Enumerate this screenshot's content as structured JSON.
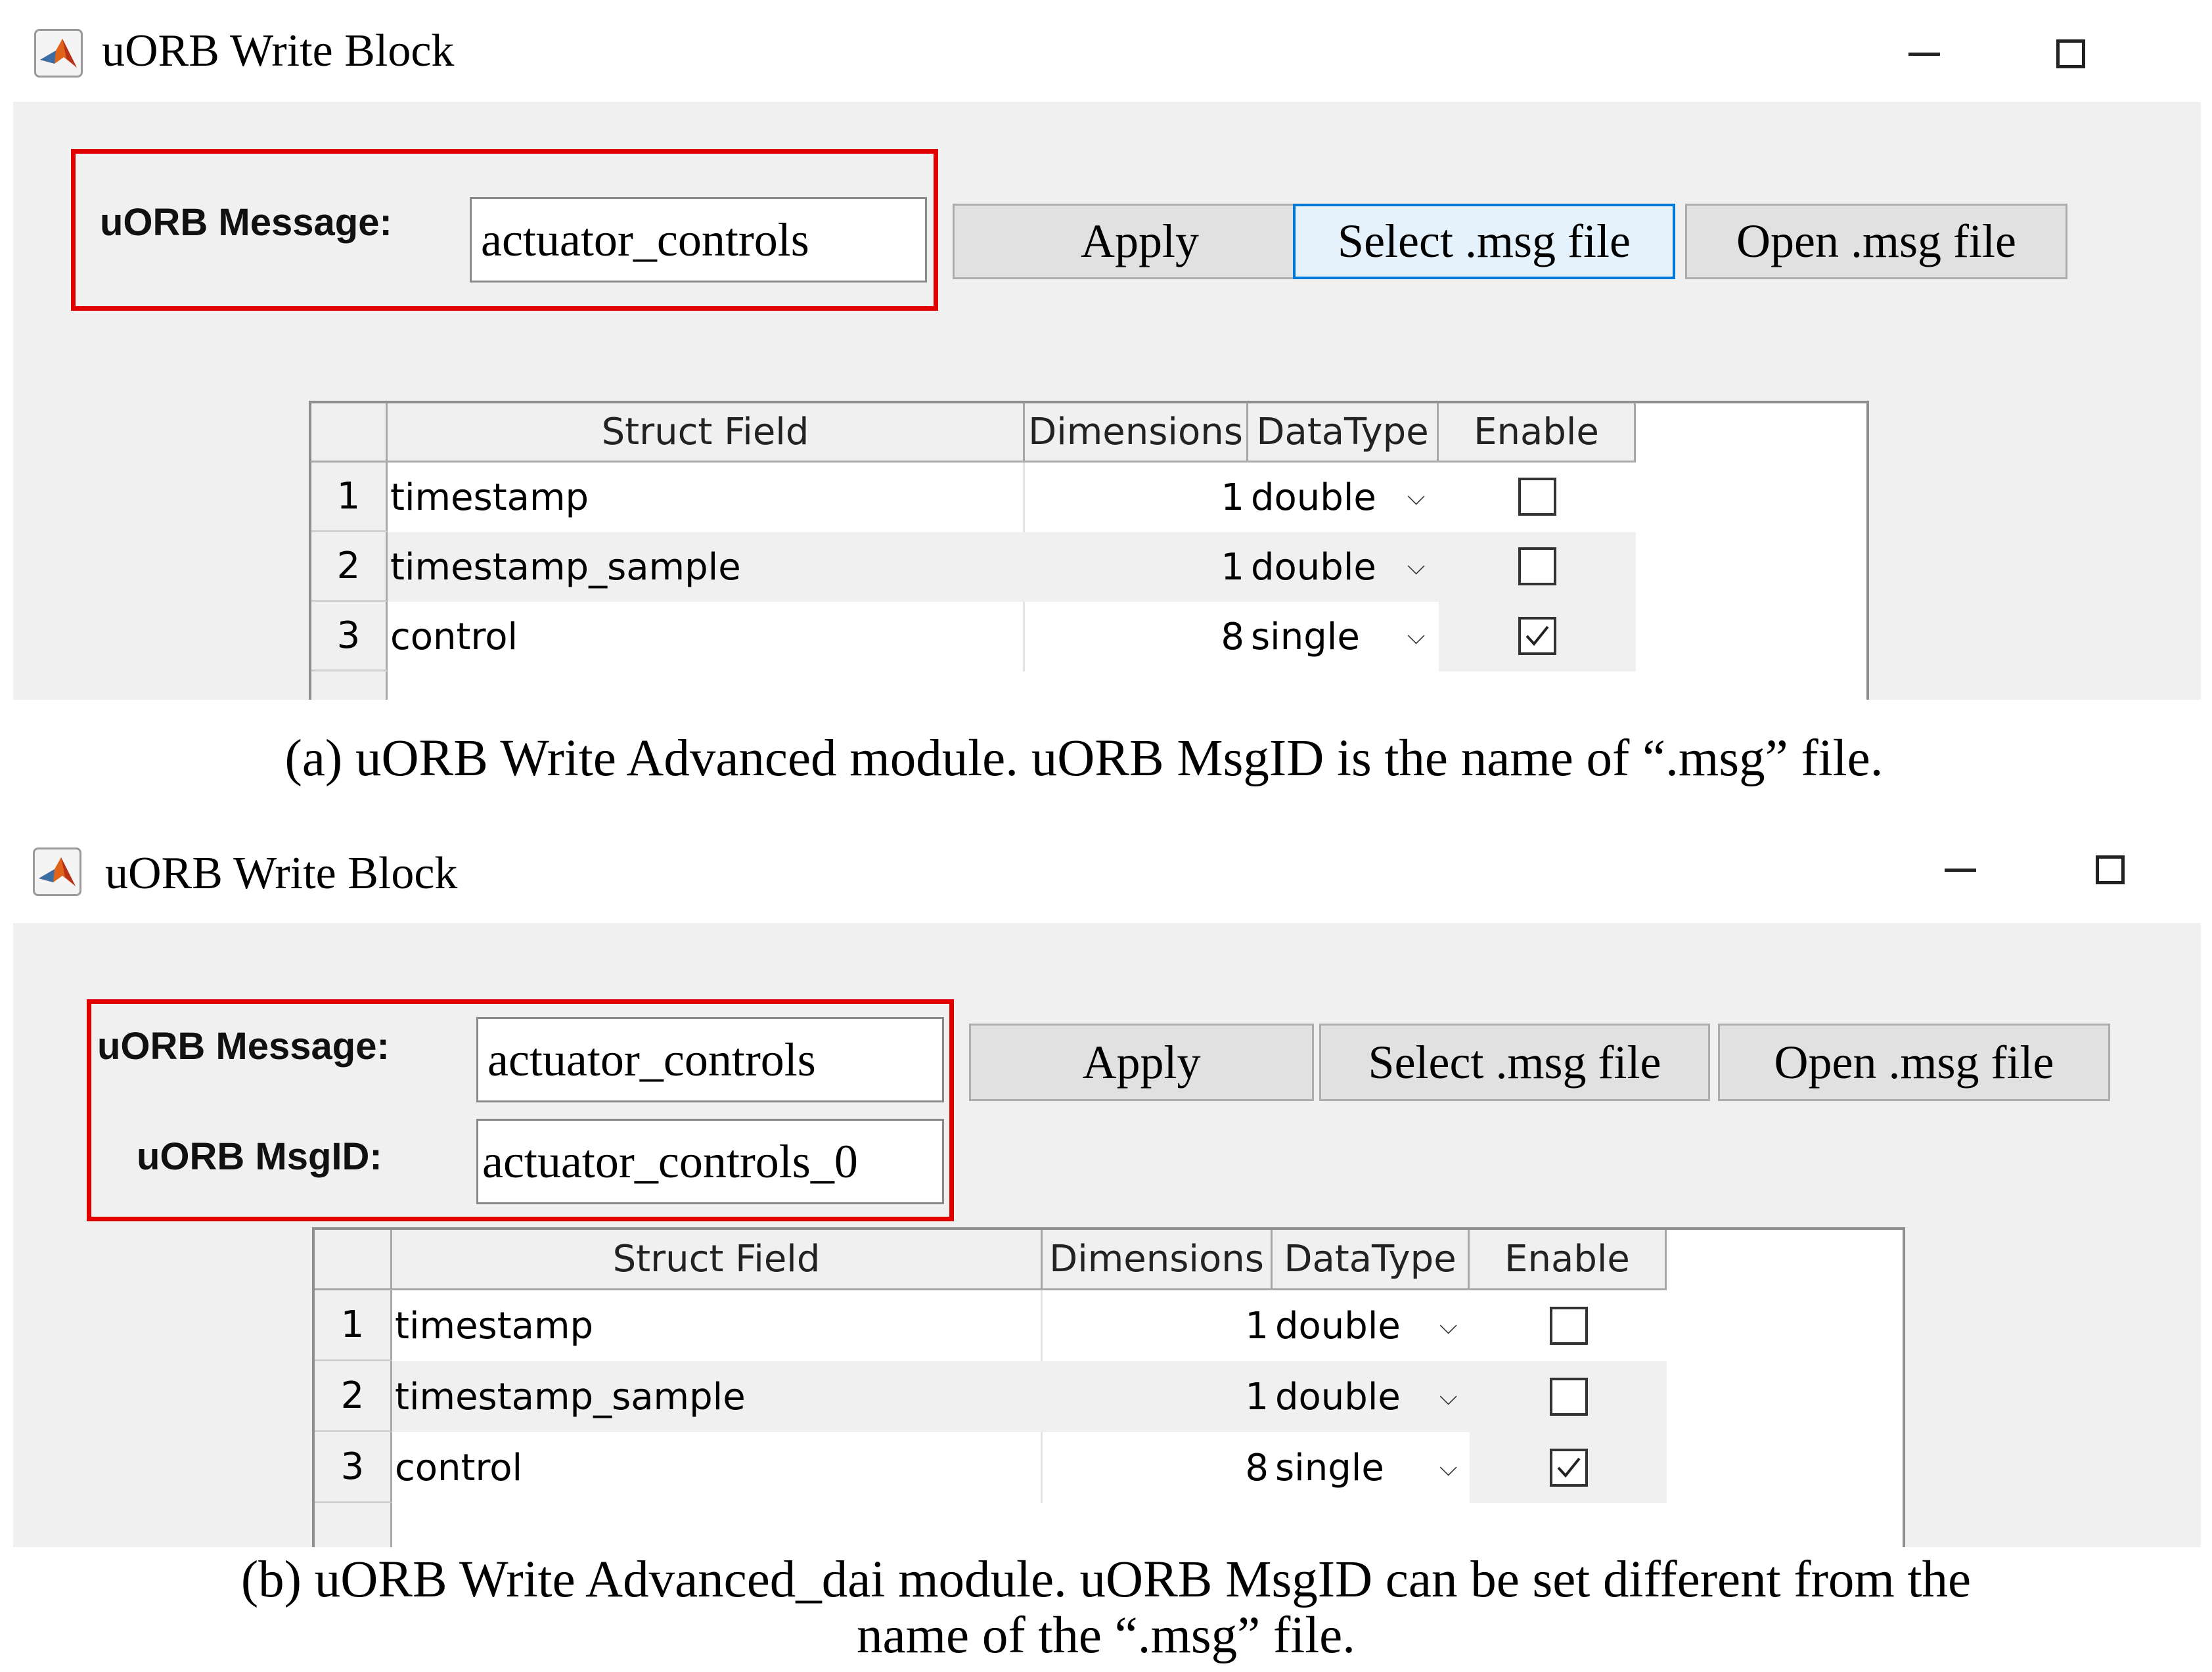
{
  "panel_a": {
    "title": "uORB Write Block",
    "message_label": "uORB Message:",
    "message_value": "actuator_controls",
    "apply_label": "Apply",
    "select_label": "Select .msg file",
    "open_label": "Open .msg file",
    "table": {
      "columns": [
        "",
        "Struct Field",
        "Dimensions",
        "DataType",
        "Enable"
      ],
      "rows": [
        {
          "num": "1",
          "field": "timestamp",
          "dim": "1",
          "type": "double",
          "enabled": false
        },
        {
          "num": "2",
          "field": "timestamp_sample",
          "dim": "1",
          "type": "double",
          "enabled": false
        },
        {
          "num": "3",
          "field": "control",
          "dim": "8",
          "type": "single",
          "enabled": true
        }
      ]
    },
    "caption": "(a) uORB Write Advanced module. uORB MsgID is the name of “.msg” file."
  },
  "panel_b": {
    "title": "uORB Write Block",
    "message_label": "uORB Message:",
    "message_value": "actuator_controls",
    "msgid_label": "uORB MsgID:",
    "msgid_value": "actuator_controls_0",
    "apply_label": "Apply",
    "select_label": "Select .msg file",
    "open_label": "Open .msg file",
    "table": {
      "columns": [
        "",
        "Struct Field",
        "Dimensions",
        "DataType",
        "Enable"
      ],
      "rows": [
        {
          "num": "1",
          "field": "timestamp",
          "dim": "1",
          "type": "double",
          "enabled": false
        },
        {
          "num": "2",
          "field": "timestamp_sample",
          "dim": "1",
          "type": "double",
          "enabled": false
        },
        {
          "num": "3",
          "field": "control",
          "dim": "8",
          "type": "single",
          "enabled": true
        }
      ]
    },
    "caption_line1": "(b) uORB Write Advanced_dai module. uORB MsgID can be set different from the",
    "caption_line2": "name of the “.msg” file."
  },
  "icons": {
    "app": "matlab-logo-icon",
    "minimize": "minimize-icon",
    "maximize": "maximize-icon",
    "dropdown": "chevron-down-icon",
    "checkbox": "checkbox-icon"
  },
  "colors": {
    "highlight_box": "#e00000",
    "focus_border": "#0078d7",
    "dialog_bg": "#f0f0f0"
  }
}
